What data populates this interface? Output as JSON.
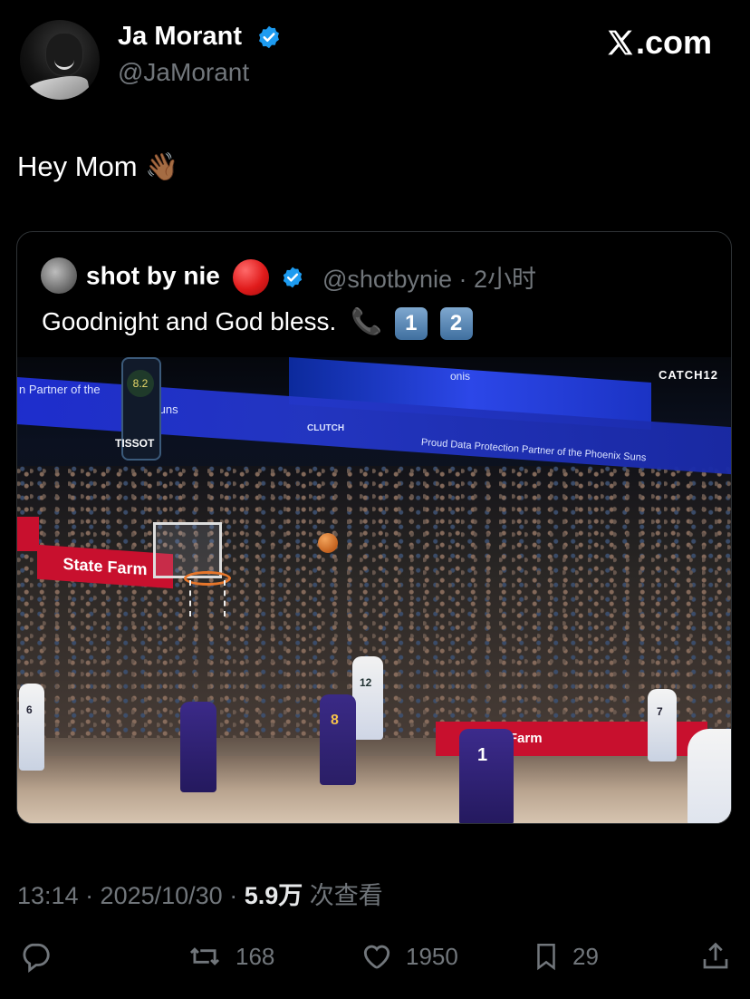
{
  "author": {
    "name": "Ja Morant",
    "handle": "@JaMorant",
    "verified": true
  },
  "brand": {
    "logo_text": ".com"
  },
  "tweet": {
    "text": "Hey Mom",
    "emoji": "👋🏾"
  },
  "quoted": {
    "name": "shot by nie",
    "handle_time": "@shotbynie · 2小时",
    "text": "Goodnight and God bless.",
    "emoji_phone": "📞",
    "keycaps": [
      "1",
      "2"
    ],
    "photo": {
      "banner_left": "n Partner of the",
      "banner_suns": "Suns",
      "banner_clutch": "CLUTCH",
      "banner_right": "Proud Data Protection Partner of the Phoenix Suns",
      "banner_top": "onis",
      "watermark": "CATCH12",
      "tissot": "TISSOT",
      "shot_clock": "8.2",
      "statefarm": "State Farm",
      "adboard": "State Farm",
      "jersey_numbers": [
        "12",
        "8",
        "1",
        "7",
        "6"
      ]
    }
  },
  "footer": {
    "time": "13:14 · 2025/10/30 · ",
    "views": "5.9万",
    "views_label": " 次查看"
  },
  "actions": {
    "retweets": "168",
    "likes": "1950",
    "bookmarks": "29"
  },
  "colors": {
    "background": "#000000",
    "text": "#e7e9ea",
    "secondary": "#71767b",
    "verified": "#1d9bf0",
    "border": "#2f3336"
  }
}
